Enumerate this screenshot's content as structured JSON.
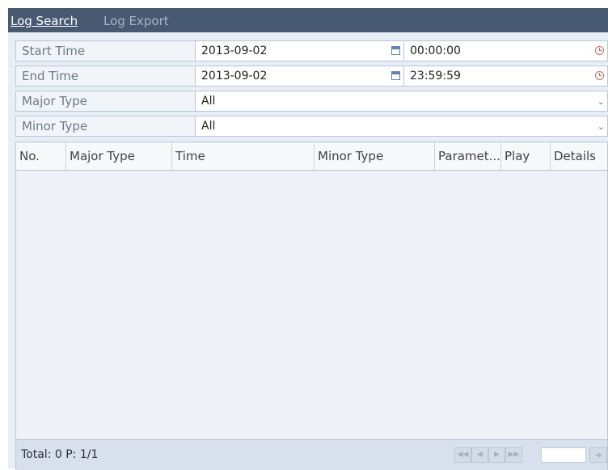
{
  "tabs": {
    "log_search": "Log Search",
    "log_export": "Log Export"
  },
  "form": {
    "start_time": {
      "label": "Start Time",
      "date": "2013-09-02",
      "time": "00:00:00"
    },
    "end_time": {
      "label": "End Time",
      "date": "2013-09-02",
      "time": "23:59:59"
    },
    "major_type": {
      "label": "Major Type",
      "value": "All"
    },
    "minor_type": {
      "label": "Minor Type",
      "value": "All"
    }
  },
  "table": {
    "columns": [
      "No.",
      "Major Type",
      "Time",
      "Minor Type",
      "Paramet...",
      "Play",
      "Details"
    ],
    "rows": []
  },
  "footer": {
    "total_label": "Total: 0  P: 1/1",
    "page_input": "",
    "first_icon": "first-page-icon",
    "prev_icon": "previous-page-icon",
    "next_icon": "next-page-icon",
    "last_icon": "last-page-icon",
    "go_icon": "go-arrow-icon"
  },
  "colors": {
    "tab_bar": "#475a72",
    "panel_bg": "#e8eef6",
    "border": "#b9c7d8"
  }
}
